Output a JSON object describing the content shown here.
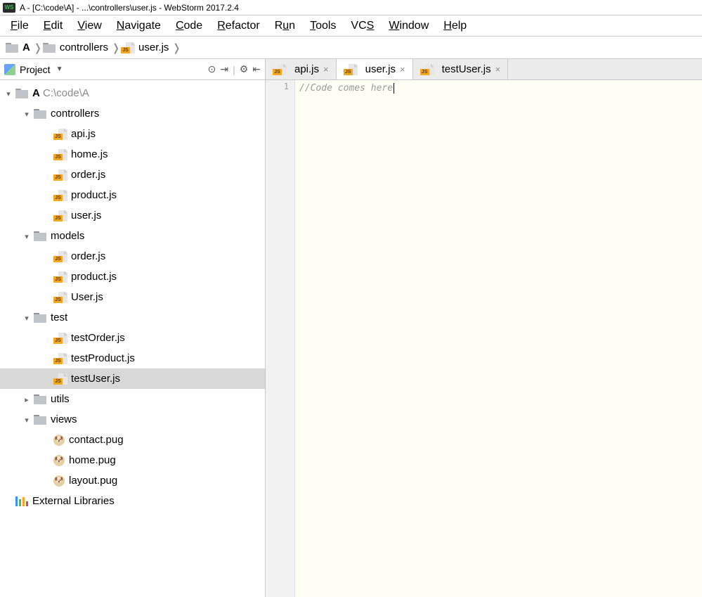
{
  "title": "A - [C:\\code\\A] - ...\\controllers\\user.js - WebStorm 2017.2.4",
  "menubar": [
    "File",
    "Edit",
    "View",
    "Navigate",
    "Code",
    "Refactor",
    "Run",
    "Tools",
    "VCS",
    "Window",
    "Help"
  ],
  "breadcrumb": [
    {
      "icon": "folder",
      "label": "A",
      "bold": true
    },
    {
      "icon": "folder",
      "label": "controllers"
    },
    {
      "icon": "js",
      "label": "user.js"
    }
  ],
  "sidebar": {
    "title": "Project",
    "root": {
      "label": "A",
      "hint": "C:\\code\\A"
    },
    "folders": [
      {
        "name": "controllers",
        "expanded": true,
        "children": [
          {
            "type": "js",
            "name": "api.js"
          },
          {
            "type": "js",
            "name": "home.js"
          },
          {
            "type": "js",
            "name": "order.js"
          },
          {
            "type": "js",
            "name": "product.js"
          },
          {
            "type": "js",
            "name": "user.js"
          }
        ]
      },
      {
        "name": "models",
        "expanded": true,
        "children": [
          {
            "type": "js",
            "name": "order.js"
          },
          {
            "type": "js",
            "name": "product.js"
          },
          {
            "type": "js",
            "name": "User.js"
          }
        ]
      },
      {
        "name": "test",
        "expanded": true,
        "children": [
          {
            "type": "js",
            "name": "testOrder.js"
          },
          {
            "type": "js",
            "name": "testProduct.js"
          },
          {
            "type": "js",
            "name": "testUser.js",
            "selected": true
          }
        ]
      },
      {
        "name": "utils",
        "expanded": false,
        "children": []
      },
      {
        "name": "views",
        "expanded": true,
        "children": [
          {
            "type": "pug",
            "name": "contact.pug"
          },
          {
            "type": "pug",
            "name": "home.pug"
          },
          {
            "type": "pug",
            "name": "layout.pug"
          }
        ]
      }
    ],
    "external": "External Libraries"
  },
  "tabs": [
    {
      "name": "api.js",
      "active": false
    },
    {
      "name": "user.js",
      "active": true
    },
    {
      "name": "testUser.js",
      "active": false
    }
  ],
  "editor": {
    "line_number": "1",
    "code": "//Code comes here"
  }
}
